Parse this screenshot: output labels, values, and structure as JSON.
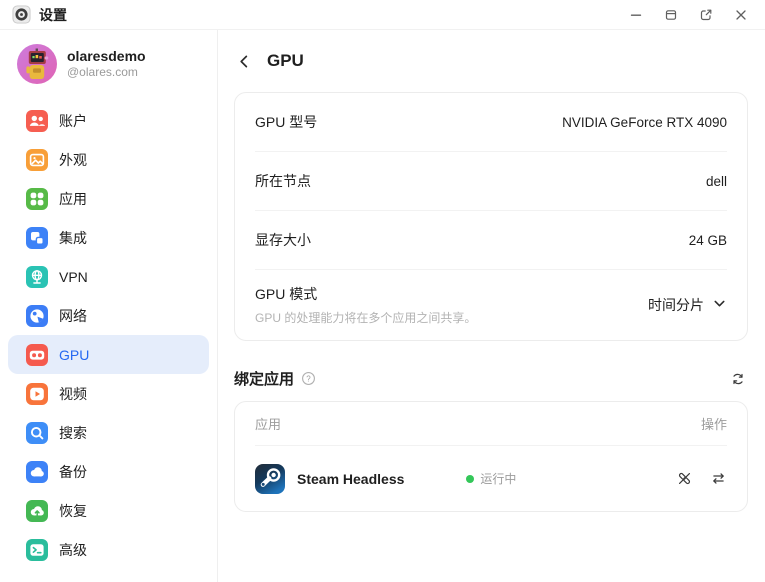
{
  "titlebar": {
    "title": "设置",
    "app_icon": "settings-gear-icon",
    "controls": [
      "minimize",
      "maximize",
      "open-external",
      "close"
    ]
  },
  "sidebar": {
    "user": {
      "name": "olaresdemo",
      "handle": "@olares.com",
      "avatar": "robot-avatar"
    },
    "items": [
      {
        "label": "账户",
        "icon": "users-icon",
        "color": "#F65E51",
        "selected": false
      },
      {
        "label": "外观",
        "icon": "appearance-icon",
        "color": "#F89F38",
        "selected": false
      },
      {
        "label": "应用",
        "icon": "apps-grid-icon",
        "color": "#57BA47",
        "selected": false
      },
      {
        "label": "集成",
        "icon": "integration-icon",
        "color": "#3D82F7",
        "selected": false
      },
      {
        "label": "VPN",
        "icon": "vpn-globe-icon",
        "color": "#2AC3B4",
        "selected": false
      },
      {
        "label": "网络",
        "icon": "network-globe-icon",
        "color": "#3C7DF6",
        "selected": false
      },
      {
        "label": "GPU",
        "icon": "gpu-card-icon",
        "color": "#F55A4E",
        "selected": true
      },
      {
        "label": "视频",
        "icon": "video-play-icon",
        "color": "#F8743B",
        "selected": false
      },
      {
        "label": "搜索",
        "icon": "search-icon",
        "color": "#3E8EF7",
        "selected": false
      },
      {
        "label": "备份",
        "icon": "backup-cloud-icon",
        "color": "#3D82F7",
        "selected": false
      },
      {
        "label": "恢复",
        "icon": "restore-cloud-icon",
        "color": "#44B854",
        "selected": false
      },
      {
        "label": "高级",
        "icon": "terminal-icon",
        "color": "#2ABD9C",
        "selected": false
      }
    ]
  },
  "main": {
    "page_title": "GPU",
    "back_icon": "chevron-left-icon",
    "info_rows": [
      {
        "label": "GPU 型号",
        "value": "NVIDIA GeForce RTX 4090"
      },
      {
        "label": "所在节点",
        "value": "dell"
      },
      {
        "label": "显存大小",
        "value": "24 GB"
      },
      {
        "label": "GPU 模式",
        "sublabel": "GPU 的处理能力将在多个应用之间共享。",
        "value": "时间分片",
        "dropdown_icon": "chevron-down-icon"
      }
    ],
    "bound_apps": {
      "section_title": "绑定应用",
      "help_icon": "question-circle-icon",
      "refresh_icon": "refresh-icon",
      "table": {
        "col_app": "应用",
        "col_action": "操作",
        "rows": [
          {
            "name": "Steam Headless",
            "app_icon": "steam-icon",
            "status": "运行中",
            "status_color": "#34C759",
            "actions": [
              "unbind-icon",
              "transfer-icon"
            ]
          }
        ]
      }
    }
  },
  "colors": {
    "accent": "#2468F2",
    "selected_bg": "#E5EDFB",
    "status_running": "#34C759"
  }
}
